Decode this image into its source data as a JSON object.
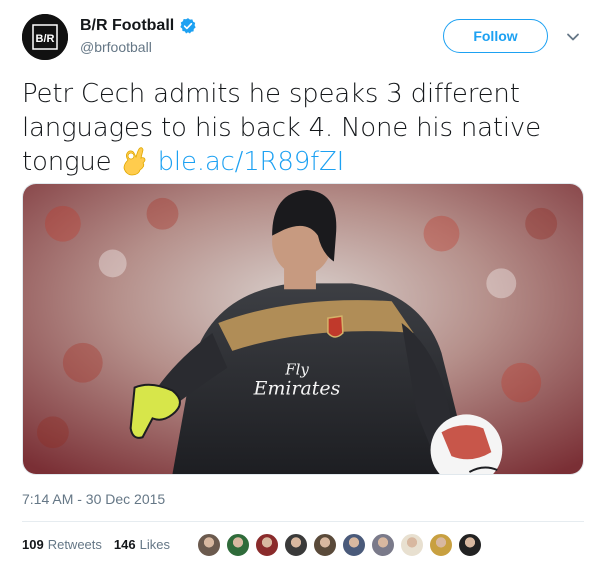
{
  "author": {
    "display_name": "B/R Football",
    "handle": "@brfootball",
    "verified": true,
    "avatar_text": "B/R"
  },
  "follow_label": "Follow",
  "tweet": {
    "text": "Petr Cech admits he speaks 3 different languages to his back 4. None his native tongue",
    "emoji": "ok-hand",
    "link": "ble.ac/1R89fZI"
  },
  "media": {
    "jersey_sponsor_line1": "Fly",
    "jersey_sponsor_line2": "Emirates"
  },
  "timestamp": "7:14 AM - 30 Dec 2015",
  "stats": {
    "retweets_count": "109",
    "retweets_label": "Retweets",
    "likes_count": "146",
    "likes_label": "Likes"
  },
  "colors": {
    "accent": "#1da1f2",
    "secondary_text": "#657786"
  },
  "likers": [
    {
      "color": "#6b5a4e"
    },
    {
      "color": "#2f6b3a"
    },
    {
      "color": "#8a2b2b"
    },
    {
      "color": "#3a3a3a"
    },
    {
      "color": "#5a4a3a"
    },
    {
      "color": "#4a5a7a"
    },
    {
      "color": "#7a7a8a"
    },
    {
      "color": "#e8e0d0"
    },
    {
      "color": "#c8a040"
    },
    {
      "color": "#222222"
    }
  ]
}
